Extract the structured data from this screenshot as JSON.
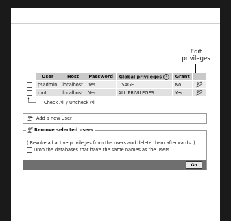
{
  "callout": {
    "line1": "Edit",
    "line2": "privileges"
  },
  "table": {
    "headers": [
      "",
      "User",
      "Host",
      "Password",
      "Global privileges",
      "Grant",
      ""
    ],
    "rows": [
      {
        "user": "psadmin",
        "host": "localhost",
        "password": "Yes",
        "privileges": "USAGE",
        "grant": "No"
      },
      {
        "user": "root",
        "host": "localhost",
        "password": "Yes",
        "privileges": "ALL PRIVILEGES",
        "grant": "Yes"
      }
    ],
    "info_glyph": "?"
  },
  "check_all": "Check All / Uncheck All",
  "add_user": "Add a new User",
  "remove": {
    "legend": "Remove selected users",
    "note": "( Revoke all active privileges from the users and delete them afterwards. )",
    "drop_label": "Drop the databases that have the same names as the users.",
    "go_label": "Go"
  },
  "icons": {
    "edit": "edit-pencil-icon",
    "add_user": "add-user-icon",
    "remove_users": "remove-users-icon",
    "check_arrow": "corner-arrow-up-icon",
    "info": "info-icon"
  }
}
